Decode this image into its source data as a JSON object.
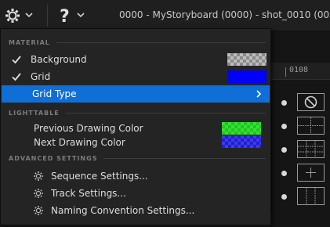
{
  "toolbar": {
    "title": "0000 - MyStoryboard (0000) - shot_0010 (0000)",
    "settings_icon": "gear-icon",
    "help_icon": "question-icon"
  },
  "ruler": {
    "label": "0108"
  },
  "menu": {
    "sections": {
      "material": "MATERIAL",
      "lightable": "LIGHTTABLE",
      "advanced": "ADVANCED SETTINGS"
    },
    "items": {
      "background": {
        "label": "Background",
        "checked": true
      },
      "grid": {
        "label": "Grid",
        "checked": true,
        "color": "#0000ff"
      },
      "grid_type": {
        "label": "Grid Type"
      },
      "previous_drawing_color": {
        "label": "Previous Drawing Color",
        "color": "#35e135"
      },
      "next_drawing_color": {
        "label": "Next Drawing Color",
        "color": "#3b3bf0"
      },
      "sequence_settings": {
        "label": "Sequence Settings..."
      },
      "track_settings": {
        "label": "Track Settings..."
      },
      "naming_convention_settings": {
        "label": "Naming Convention Settings..."
      }
    }
  },
  "grid_types": {
    "options": [
      "none",
      "center-cross",
      "thirds",
      "center-plus",
      "vertical-thirds"
    ],
    "selected": "center-cross"
  },
  "colors": {
    "highlight": "#0f6fd6",
    "menu_bg": "#242424"
  }
}
